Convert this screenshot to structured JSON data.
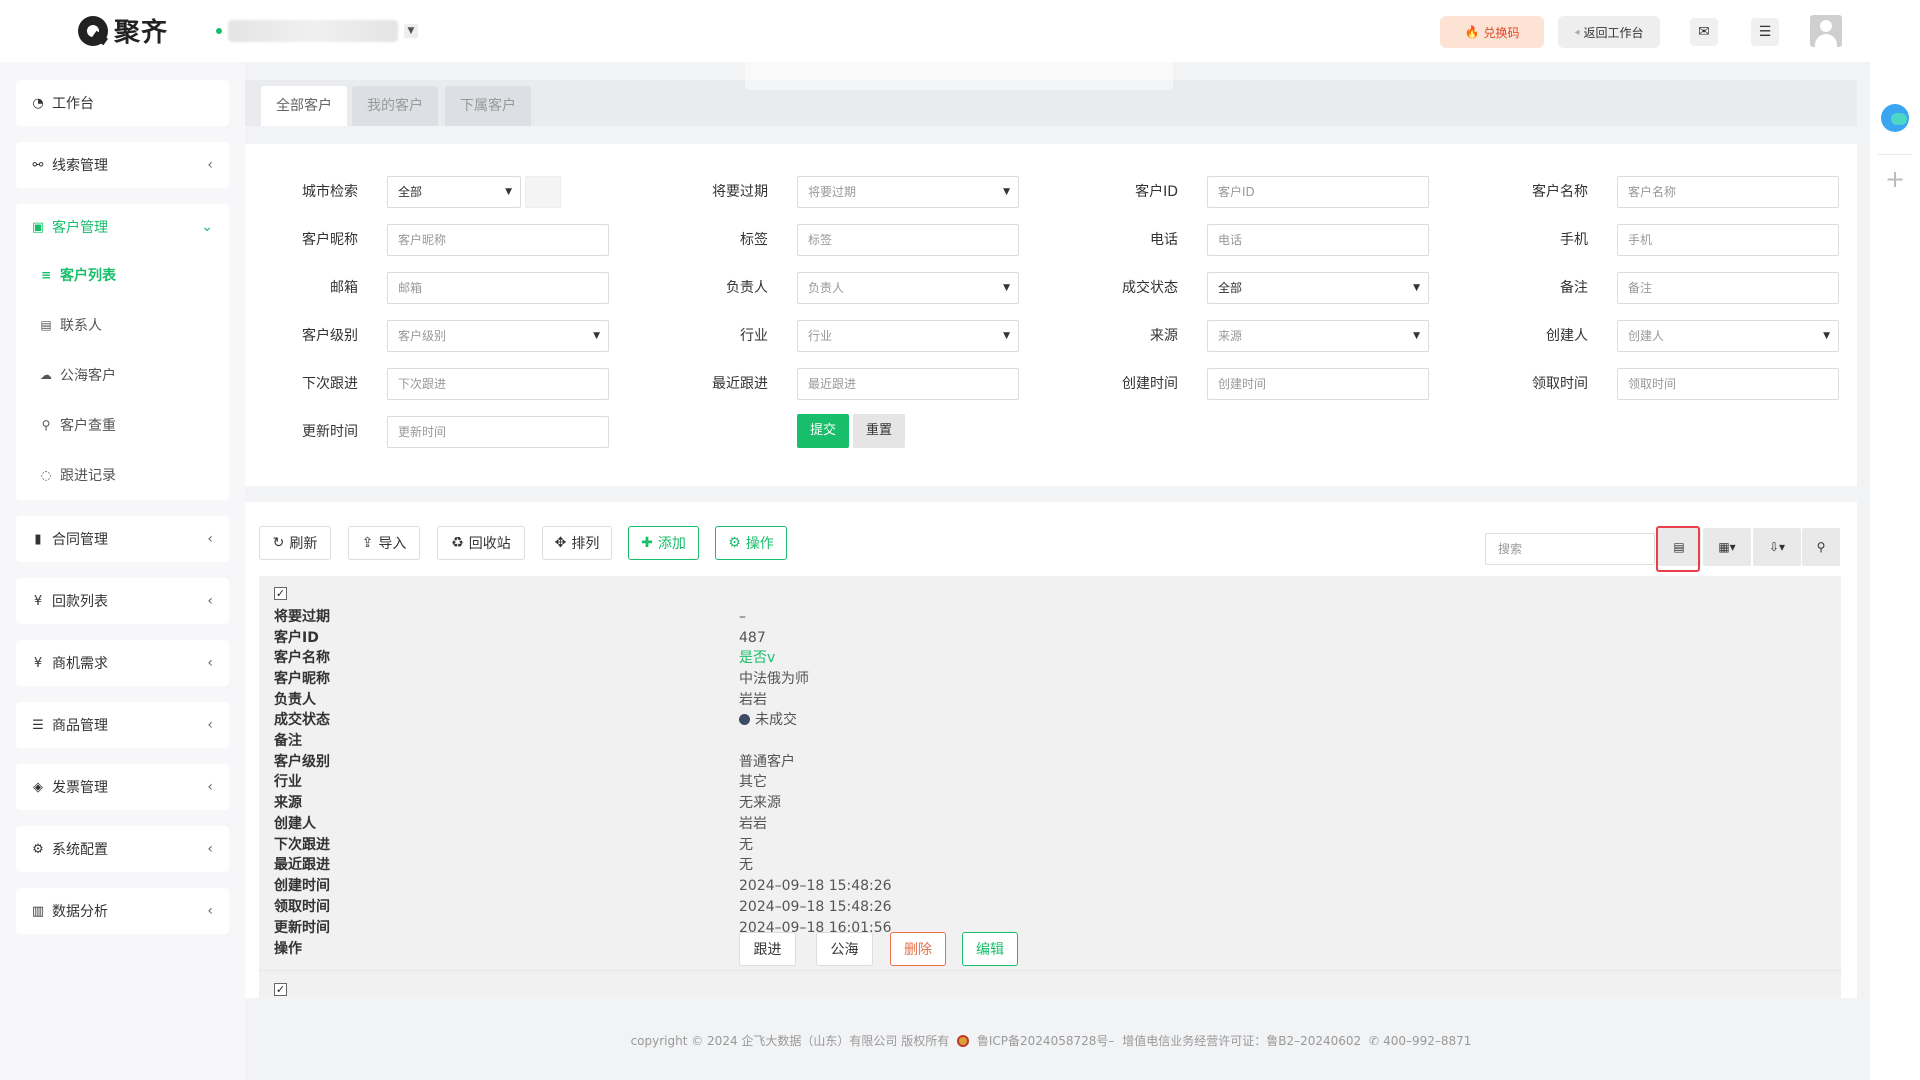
{
  "header": {
    "logo_text": "聚齐",
    "redeem_label": "兑换码",
    "back_label": "返回工作台"
  },
  "sidebar": {
    "items": [
      {
        "label": "工作台",
        "icon": "dashboard-icon"
      },
      {
        "label": "线索管理",
        "icon": "link-icon"
      },
      {
        "label": "客户管理",
        "icon": "id-card-icon"
      },
      {
        "label": "合同管理",
        "icon": "bookmark-icon"
      },
      {
        "label": "回款列表",
        "icon": "yen-icon"
      },
      {
        "label": "商机需求",
        "icon": "yen-icon"
      },
      {
        "label": "商品管理",
        "icon": "list-icon"
      },
      {
        "label": "发票管理",
        "icon": "tag-icon"
      },
      {
        "label": "系统配置",
        "icon": "gears-icon"
      },
      {
        "label": "数据分析",
        "icon": "bar-chart-icon"
      }
    ],
    "sub_items": [
      {
        "label": "客户列表",
        "icon": "list-icon"
      },
      {
        "label": "联系人",
        "icon": "contact-icon"
      },
      {
        "label": "公海客户",
        "icon": "cloud-icon"
      },
      {
        "label": "客户查重",
        "icon": "search-icon"
      },
      {
        "label": "跟进记录",
        "icon": "comments-icon"
      }
    ]
  },
  "tabs": [
    "全部客户",
    "我的客户",
    "下属客户"
  ],
  "filter": {
    "city_label": "城市检索",
    "city_value": "全部",
    "expire_label": "将要过期",
    "expire_placeholder": "将要过期",
    "cid_label": "客户ID",
    "cid_placeholder": "客户ID",
    "cname_label": "客户名称",
    "cname_placeholder": "客户名称",
    "nick_label": "客户昵称",
    "nick_placeholder": "客户昵称",
    "tag_label": "标签",
    "tag_placeholder": "标签",
    "phone_label": "电话",
    "phone_placeholder": "电话",
    "mobile_label": "手机",
    "mobile_placeholder": "手机",
    "email_label": "邮箱",
    "email_placeholder": "邮箱",
    "owner_label": "负责人",
    "owner_placeholder": "负责人",
    "deal_label": "成交状态",
    "deal_value": "全部",
    "remark_label": "备注",
    "remark_placeholder": "备注",
    "level_label": "客户级别",
    "level_placeholder": "客户级别",
    "industry_label": "行业",
    "industry_placeholder": "行业",
    "source_label": "来源",
    "source_placeholder": "来源",
    "creator_label": "创建人",
    "creator_placeholder": "创建人",
    "next_label": "下次跟进",
    "next_placeholder": "下次跟进",
    "recent_label": "最近跟进",
    "recent_placeholder": "最近跟进",
    "ctime_label": "创建时间",
    "ctime_placeholder": "创建时间",
    "rtime_label": "领取时间",
    "rtime_placeholder": "领取时间",
    "utime_label": "更新时间",
    "utime_placeholder": "更新时间",
    "submit_label": "提交",
    "reset_label": "重置"
  },
  "toolbar": {
    "refresh": "刷新",
    "import": "导入",
    "recycle": "回收站",
    "sort": "排列",
    "add": "添加",
    "operate": "操作",
    "search_placeholder": "搜索"
  },
  "record": {
    "fields": [
      {
        "label": "将要过期",
        "value": "–"
      },
      {
        "label": "客户ID",
        "value": "487"
      },
      {
        "label": "客户名称",
        "value": "是否v"
      },
      {
        "label": "客户昵称",
        "value": "中法俄为师"
      },
      {
        "label": "负责人",
        "value": "岩岩"
      },
      {
        "label": "成交状态",
        "value": "未成交"
      },
      {
        "label": "备注",
        "value": ""
      },
      {
        "label": "客户级别",
        "value": "普通客户"
      },
      {
        "label": "行业",
        "value": "其它"
      },
      {
        "label": "来源",
        "value": "无来源"
      },
      {
        "label": "创建人",
        "value": "岩岩"
      },
      {
        "label": "下次跟进",
        "value": "无"
      },
      {
        "label": "最近跟进",
        "value": "无"
      },
      {
        "label": "创建时间",
        "value": "2024–09–18 15:48:26"
      },
      {
        "label": "领取时间",
        "value": "2024–09–18 15:48:26"
      },
      {
        "label": "更新时间",
        "value": "2024–09–18 16:01:56"
      },
      {
        "label": "操作",
        "value": ""
      }
    ],
    "actions": {
      "follow": "跟进",
      "public": "公海",
      "delete": "删除",
      "edit": "编辑"
    }
  },
  "footer": {
    "copyright": "copyright © 2024 企飞大数据（山东）有限公司 版权所有",
    "icp": "鲁ICP备2024058728号–",
    "license": "增值电信业务经营许可证：鲁B2–20240602",
    "phone": "400–992–8871"
  },
  "colors": {
    "accent": "#19be6b",
    "danger": "#e8704a",
    "highlight": "#e8404a"
  }
}
